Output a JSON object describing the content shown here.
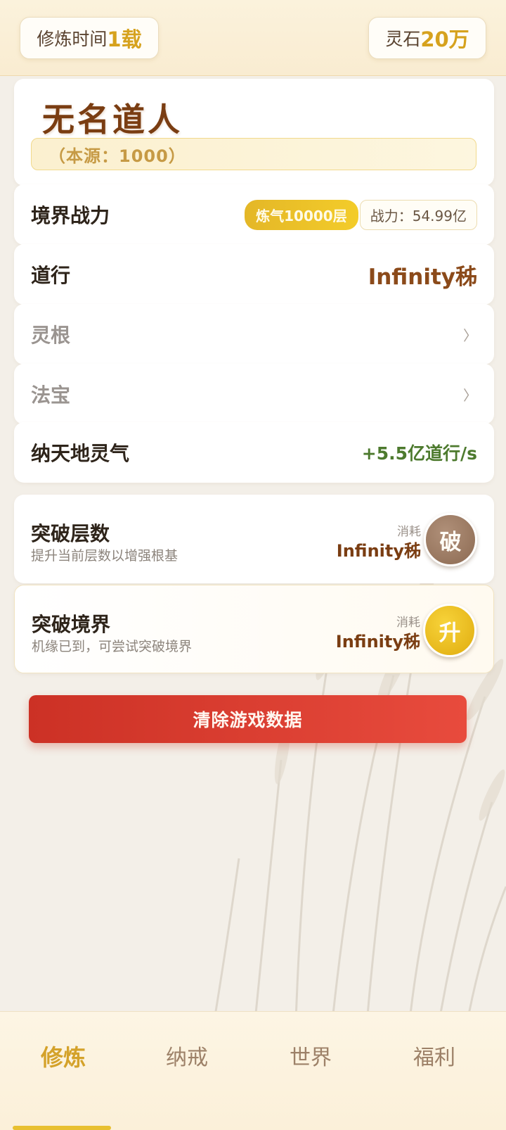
{
  "top_bar": {
    "time_label": "修炼时间",
    "time_value": "1载",
    "stone_label": "灵石",
    "stone_value": "20万"
  },
  "character": {
    "name": "无名道人",
    "origin": "（本源：1000）"
  },
  "stats": {
    "realm_power_label": "境界战力",
    "realm_badge": "炼气10000层",
    "power": "战力：54.99亿",
    "daoxing_label": "道行",
    "daoxing_value": "Infinity秭",
    "linggen_label": "灵根",
    "fabao_label": "法宝",
    "absorb_label": "纳天地灵气",
    "absorb_value": "+5.5亿道行/s",
    "chevron": "〉"
  },
  "actions": [
    {
      "title": "突破层数",
      "desc": "提升当前层数以增强根基",
      "cost_label": "消耗",
      "cost_value": "Infinity秭",
      "button": "破"
    },
    {
      "title": "突破境界",
      "desc": "机缘已到，可尝试突破境界",
      "cost_label": "消耗",
      "cost_value": "Infinity秭",
      "button": "升"
    }
  ],
  "clear_button": "清除游戏数据",
  "nav": {
    "items": [
      "修炼",
      "纳戒",
      "世界",
      "福利"
    ],
    "active": "修炼"
  },
  "colors": {
    "accent_gold": "#d6a21e",
    "brown": "#7a3d12",
    "danger": "#d93a2d",
    "green": "#4d7a2e"
  }
}
